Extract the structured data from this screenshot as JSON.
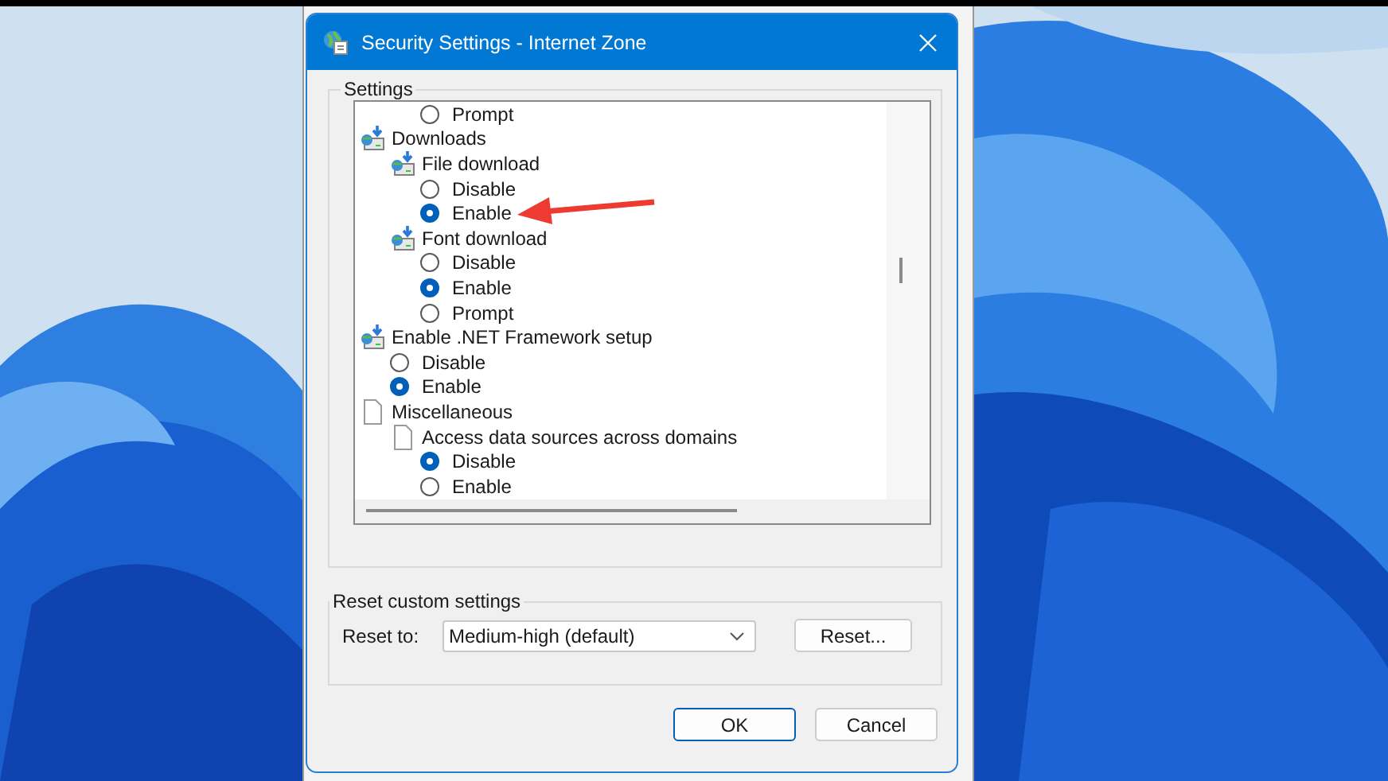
{
  "window": {
    "title": "Security Settings - Internet Zone"
  },
  "settings": {
    "title": "Settings",
    "tree": [
      {
        "children": [
          {
            "children": [
              {
                "kind": "option",
                "label": "Prompt",
                "selected": false
              }
            ]
          }
        ]
      },
      {
        "kind": "download-group",
        "label": "Downloads",
        "children": [
          {
            "kind": "download-group",
            "label": "File download",
            "children": [
              {
                "kind": "option",
                "label": "Disable",
                "selected": false
              },
              {
                "kind": "option",
                "label": "Enable",
                "selected": true
              }
            ]
          },
          {
            "kind": "download-group",
            "label": "Font download",
            "children": [
              {
                "kind": "option",
                "label": "Disable",
                "selected": false
              },
              {
                "kind": "option",
                "label": "Enable",
                "selected": true
              },
              {
                "kind": "option",
                "label": "Prompt",
                "selected": false
              }
            ]
          }
        ]
      },
      {
        "kind": "download-group",
        "label": "Enable .NET Framework setup",
        "children": [
          {
            "kind": "option",
            "label": "Disable",
            "selected": false
          },
          {
            "kind": "option",
            "label": "Enable",
            "selected": true
          }
        ]
      },
      {
        "kind": "page-group",
        "label": "Miscellaneous",
        "children": [
          {
            "kind": "page-group",
            "label": "Access data sources across domains",
            "children": [
              {
                "kind": "option",
                "label": "Disable",
                "selected": true
              },
              {
                "kind": "option",
                "label": "Enable",
                "selected": false
              }
            ]
          }
        ]
      }
    ]
  },
  "reset": {
    "title": "Reset custom settings",
    "label": "Reset to:",
    "value": "Medium-high (default)",
    "button": "Reset..."
  },
  "buttons": [
    "OK",
    "Cancel"
  ]
}
